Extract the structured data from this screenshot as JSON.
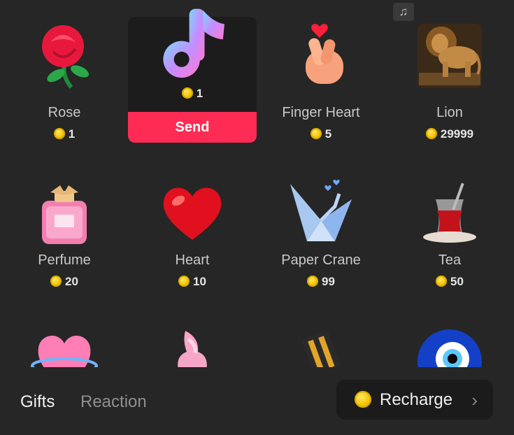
{
  "gifts": [
    {
      "name": "Rose",
      "price": "1",
      "icon": "rose-icon"
    },
    {
      "name": "",
      "price": "1",
      "icon": "tiktok-note-icon",
      "selected": true
    },
    {
      "name": "Finger Heart",
      "price": "5",
      "icon": "finger-heart-icon"
    },
    {
      "name": "Lion",
      "price": "29999",
      "icon": "lion-icon"
    },
    {
      "name": "Perfume",
      "price": "20",
      "icon": "perfume-icon"
    },
    {
      "name": "Heart",
      "price": "10",
      "icon": "heart-icon"
    },
    {
      "name": "Paper Crane",
      "price": "99",
      "icon": "paper-crane-icon"
    },
    {
      "name": "Tea",
      "price": "50",
      "icon": "tea-icon"
    }
  ],
  "selected_gift": {
    "price": "1",
    "send_label": "Send"
  },
  "tabs": {
    "gifts": "Gifts",
    "reaction": "Reaction"
  },
  "recharge": {
    "label": "Recharge"
  },
  "music_badge": "music-note-icon",
  "colors": {
    "accent": "#fe2c55",
    "coin": "#f5c400",
    "background": "#262626"
  }
}
